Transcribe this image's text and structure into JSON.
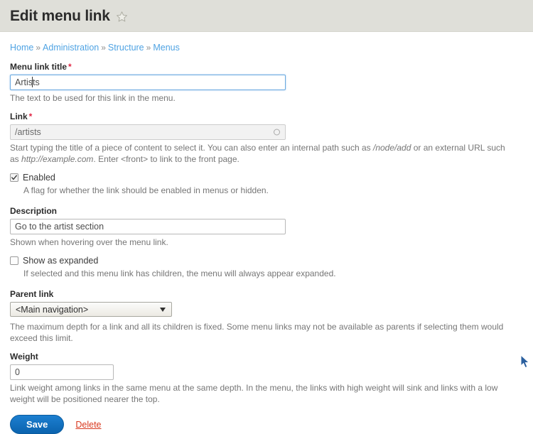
{
  "header": {
    "title": "Edit menu link",
    "star_icon": "star-outline-icon"
  },
  "breadcrumb": {
    "items": [
      {
        "label": "Home"
      },
      {
        "label": "Administration"
      },
      {
        "label": "Structure"
      },
      {
        "label": "Menus"
      }
    ],
    "separator": "»"
  },
  "form": {
    "menu_link_title": {
      "label": "Menu link title",
      "required_marker": "*",
      "value": "Artists",
      "placeholder": "",
      "description": "The text to be used for this link in the menu."
    },
    "link": {
      "label": "Link",
      "required_marker": "*",
      "value": "/artists",
      "placeholder": "",
      "icon": "autocomplete-throbber-icon",
      "description_1": "Start typing the title of a piece of content to select it. You can also enter an internal path such as ",
      "description_em_1": "/node/add",
      "description_2": " or an external URL such as ",
      "description_em_2": "http://example.com",
      "description_3": ". Enter <front> to link to the front page."
    },
    "enabled": {
      "label": "Enabled",
      "checked": true,
      "description": "A flag for whether the link should be enabled in menus or hidden."
    },
    "description_field": {
      "label": "Description",
      "value": "Go to the artist section",
      "placeholder": "",
      "description": "Shown when hovering over the menu link."
    },
    "show_as_expanded": {
      "label": "Show as expanded",
      "checked": false,
      "description": "If selected and this menu link has children, the menu will always appear expanded."
    },
    "parent_link": {
      "label": "Parent link",
      "selected": "<Main navigation>",
      "options": [
        "<Main navigation>"
      ],
      "description": "The maximum depth for a link and all its children is fixed. Some menu links may not be available as parents if selecting them would exceed this limit."
    },
    "weight": {
      "label": "Weight",
      "value": "0",
      "placeholder": "",
      "description": "Link weight among links in the same menu at the same depth. In the menu, the links with high weight will sink and links with a low weight will be positioned nearer the top."
    }
  },
  "actions": {
    "save_label": "Save",
    "delete_label": "Delete"
  },
  "colors": {
    "header_band": "#dfdfd9",
    "link_blue": "#4fa3e3",
    "required_red": "#e02443",
    "delete_red": "#d9381e",
    "save_blue": "#0b63ae",
    "focus_blue": "#6aa9e0",
    "help_text": "#767676"
  }
}
